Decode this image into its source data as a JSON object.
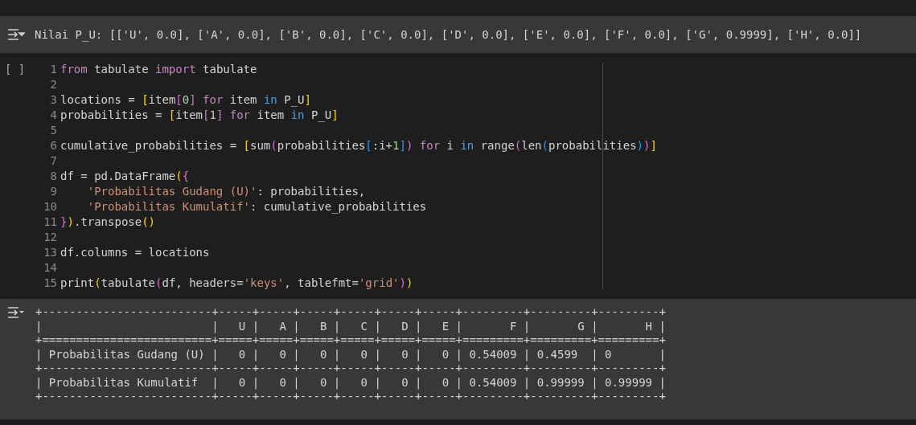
{
  "prev_output": {
    "text": "Nilai P_U: [['U', 0.0], ['A', 0.0], ['B', 0.0], ['C', 0.0], ['D', 0.0], ['E', 0.0], ['F', 0.0], ['G', 0.9999], ['H', 0.0]]"
  },
  "cell": {
    "run_label": "[ ]",
    "lines": [
      {
        "number": "1",
        "tokens": [
          {
            "kind": "kw",
            "text": "from"
          },
          {
            "kind": "plain",
            "text": " tabulate "
          },
          {
            "kind": "kw",
            "text": "import"
          },
          {
            "kind": "plain",
            "text": " tabulate"
          }
        ]
      },
      {
        "number": "2"
      },
      {
        "number": "3",
        "tokens": [
          {
            "kind": "plain",
            "text": "locations = "
          },
          {
            "kind": "b1",
            "text": "["
          },
          {
            "kind": "plain",
            "text": "item"
          },
          {
            "kind": "b2",
            "text": "["
          },
          {
            "kind": "num",
            "text": "0"
          },
          {
            "kind": "b2",
            "text": "] "
          },
          {
            "kind": "kw",
            "text": "for"
          },
          {
            "kind": "plain",
            "text": " item "
          },
          {
            "kind": "kw2",
            "text": "in"
          },
          {
            "kind": "plain",
            "text": " P_U"
          },
          {
            "kind": "b1",
            "text": "]"
          }
        ]
      },
      {
        "number": "4",
        "tokens": [
          {
            "kind": "plain",
            "text": "probabilities = "
          },
          {
            "kind": "b1",
            "text": "["
          },
          {
            "kind": "plain",
            "text": "item"
          },
          {
            "kind": "b2",
            "text": "["
          },
          {
            "kind": "num",
            "text": "1"
          },
          {
            "kind": "b2",
            "text": "] "
          },
          {
            "kind": "kw",
            "text": "for"
          },
          {
            "kind": "plain",
            "text": " item "
          },
          {
            "kind": "kw2",
            "text": "in"
          },
          {
            "kind": "plain",
            "text": " P_U"
          },
          {
            "kind": "b1",
            "text": "]"
          }
        ]
      },
      {
        "number": "5"
      },
      {
        "number": "6",
        "tokens": [
          {
            "kind": "plain",
            "text": "cumulative_probabilities = "
          },
          {
            "kind": "b1",
            "text": "["
          },
          {
            "kind": "plain",
            "text": "sum"
          },
          {
            "kind": "b2",
            "text": "("
          },
          {
            "kind": "plain",
            "text": "probabilities"
          },
          {
            "kind": "b3",
            "text": "["
          },
          {
            "kind": "plain",
            "text": ":i+"
          },
          {
            "kind": "num",
            "text": "1"
          },
          {
            "kind": "b3",
            "text": "]"
          },
          {
            "kind": "b2",
            "text": ") "
          },
          {
            "kind": "kw",
            "text": "for"
          },
          {
            "kind": "plain",
            "text": " i "
          },
          {
            "kind": "kw2",
            "text": "in"
          },
          {
            "kind": "plain",
            "text": " range"
          },
          {
            "kind": "b2",
            "text": "("
          },
          {
            "kind": "plain",
            "text": "len"
          },
          {
            "kind": "b3",
            "text": "("
          },
          {
            "kind": "plain",
            "text": "probabilities"
          },
          {
            "kind": "b3",
            "text": ")"
          },
          {
            "kind": "b2",
            "text": ")"
          },
          {
            "kind": "b1",
            "text": "]"
          }
        ]
      },
      {
        "number": "7"
      },
      {
        "number": "8",
        "tokens": [
          {
            "kind": "plain",
            "text": "df = pd.DataFrame"
          },
          {
            "kind": "b1",
            "text": "("
          },
          {
            "kind": "b2",
            "text": "{"
          }
        ]
      },
      {
        "number": "9",
        "tokens": [
          {
            "kind": "str",
            "text": "    'Probabilitas Gudang (U)'"
          },
          {
            "kind": "plain",
            "text": ": probabilities,"
          }
        ]
      },
      {
        "number": "10",
        "tokens": [
          {
            "kind": "str",
            "text": "    'Probabilitas Kumulatif'"
          },
          {
            "kind": "plain",
            "text": ": cumulative_probabilities"
          }
        ]
      },
      {
        "number": "11",
        "tokens": [
          {
            "kind": "b2",
            "text": "}"
          },
          {
            "kind": "b1",
            "text": ")"
          },
          {
            "kind": "plain",
            "text": ".transpose"
          },
          {
            "kind": "b1",
            "text": "()"
          }
        ]
      },
      {
        "number": "12"
      },
      {
        "number": "13",
        "tokens": [
          {
            "kind": "plain",
            "text": "df.columns = locations"
          }
        ]
      },
      {
        "number": "14"
      },
      {
        "number": "15",
        "tokens": [
          {
            "kind": "plain",
            "text": "print"
          },
          {
            "kind": "b1",
            "text": "("
          },
          {
            "kind": "plain",
            "text": "tabulate"
          },
          {
            "kind": "b2",
            "text": "("
          },
          {
            "kind": "plain",
            "text": "df, headers="
          },
          {
            "kind": "str",
            "text": "'keys'"
          },
          {
            "kind": "plain",
            "text": ", tablefmt="
          },
          {
            "kind": "str",
            "text": "'grid'"
          },
          {
            "kind": "b2",
            "text": ")"
          },
          {
            "kind": "b1",
            "text": ")"
          }
        ]
      }
    ]
  },
  "output": {
    "lines": [
      "+-------------------------+-----+-----+-----+-----+-----+-----+---------+---------+---------+",
      "|                         |   U |   A |   B |   C |   D |   E |       F |       G |       H |",
      "+=========================+=====+=====+=====+=====+=====+=====+=========+=========+=========+",
      "| Probabilitas Gudang (U) |   0 |   0 |   0 |   0 |   0 |   0 | 0.54009 | 0.4599  | 0       |",
      "+-------------------------+-----+-----+-----+-----+-----+-----+---------+---------+---------+",
      "| Probabilitas Kumulatif  |   0 |   0 |   0 |   0 |   0 |   0 | 0.54009 | 0.99999 | 0.99999 |",
      "+-------------------------+-----+-----+-----+-----+-----+-----+---------+---------+---------+"
    ]
  }
}
